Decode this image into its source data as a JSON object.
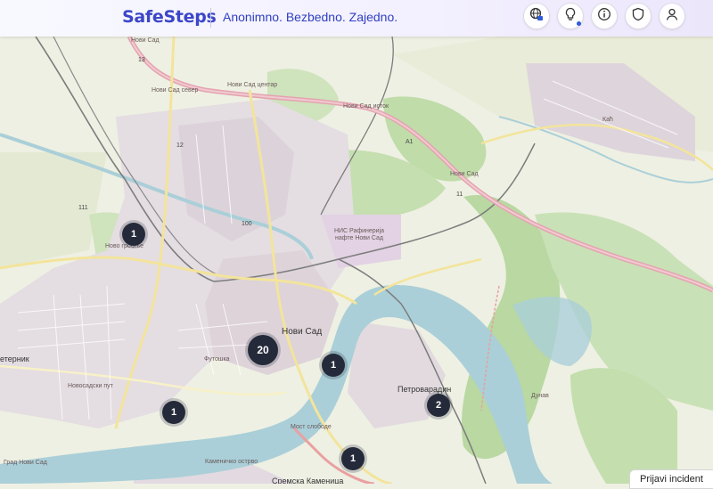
{
  "header": {
    "brand": "SafeSteps",
    "tagline": "Anonimno. Bezbedno. Zajedno.",
    "buttons": [
      {
        "name": "language-map-button",
        "icon": "globe-icon"
      },
      {
        "name": "tips-button",
        "icon": "lightbulb-icon"
      },
      {
        "name": "info-button",
        "icon": "info-icon"
      },
      {
        "name": "safety-button",
        "icon": "shield-icon"
      },
      {
        "name": "account-button",
        "icon": "user-icon"
      }
    ]
  },
  "map": {
    "labels": {
      "novi_sad_top": "Нови Сад",
      "novi_sad_sever": "Нови Сад север",
      "novi_sad_centar": "Нови Сад центар",
      "novi_sad_istok": "Нови Сад исток",
      "nis_rafinerija": "НИС Рафинерија нафте Нови Сад",
      "novi_sad_a1": "Нови Сад",
      "city_novi_sad": "Нови Сад",
      "petrovaradin": "Петроварадин",
      "novo_groblje": "Ново гробље",
      "most_slobode": "Мост слободе",
      "kac": "Каћ",
      "veternik": "етерник",
      "sremska_kamenica": "Сремска Каменица",
      "futoska": "Футошка",
      "novosadski_put": "Новосадски пут",
      "route_12": "12",
      "route_100": "100",
      "route_111": "111",
      "route_a1": "A1",
      "route_13": "13",
      "route_11": "11",
      "grad_novi_sad": "Град Нови Сад",
      "kamenicko_ostrvo": "Каменичко острво",
      "dunav": "Дунав"
    },
    "clusters": [
      {
        "count": "1"
      },
      {
        "count": "20"
      },
      {
        "count": "1"
      },
      {
        "count": "1"
      },
      {
        "count": "2"
      },
      {
        "count": "1"
      }
    ]
  },
  "report_button": "Prijavi incident",
  "colors": {
    "brand": "#3b46c8",
    "cluster": "#252a3a",
    "river": "#aacfd8",
    "highway": "#e3a4b0"
  }
}
